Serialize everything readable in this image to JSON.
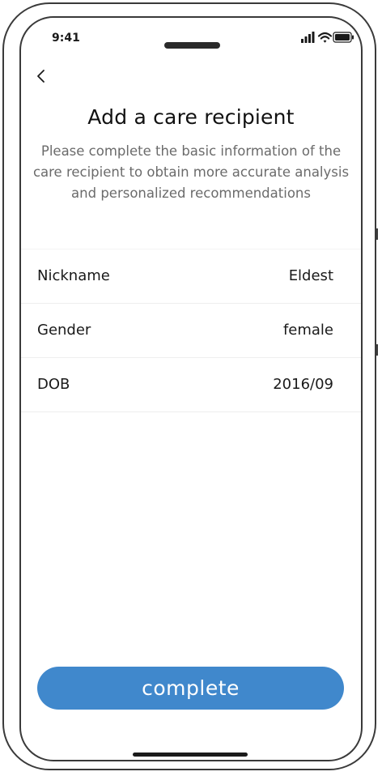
{
  "status_bar": {
    "time": "9:41",
    "icons": [
      "cellular-signal-icon",
      "wifi-icon",
      "battery-icon"
    ]
  },
  "nav": {
    "back_icon": "chevron-left-icon"
  },
  "header": {
    "title": "Add a care recipient",
    "subtitle": "Please complete the basic information of the care recipient to obtain more accurate analysis and personalized recommendations"
  },
  "form": {
    "rows": [
      {
        "label": "Nickname",
        "value": "Eldest"
      },
      {
        "label": "Gender",
        "value": "female"
      },
      {
        "label": "DOB",
        "value": "2016/09"
      }
    ]
  },
  "actions": {
    "complete_label": "complete"
  },
  "colors": {
    "accent": "#4088cc",
    "subtitle_text": "#6b6b6b",
    "frame": "#3a3a3a"
  }
}
